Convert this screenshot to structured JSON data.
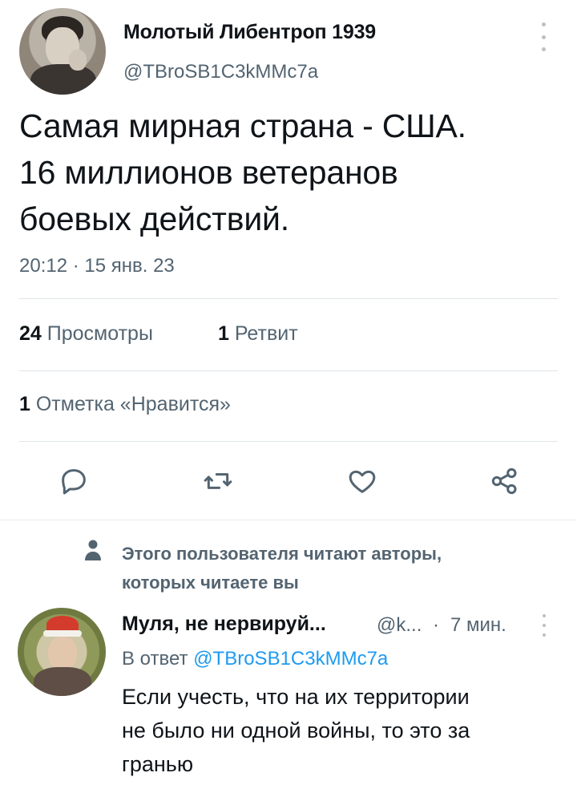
{
  "tweet": {
    "author_name": "Молотый Либентроп 1939",
    "author_handle": "@TBroSB1C3kMMc7a",
    "text": "Самая мирная страна - США.\n16 миллионов ветеранов\nбоевых действий.",
    "timestamp": "20:12 · 15 янв. 23",
    "views_count": "24",
    "views_label": "Просмотры",
    "retweets_count": "1",
    "retweets_label": "Ретвит",
    "likes_count": "1",
    "likes_label": "Отметка «Нравится»"
  },
  "actions": {
    "icons": [
      "reply-icon",
      "retweet-icon",
      "like-icon",
      "share-icon"
    ]
  },
  "social_context": {
    "text": "Этого пользователя читают авторы,\nкоторых читаете вы",
    "icon": "person-icon"
  },
  "reply": {
    "author_name": "Муля, не нервируй...",
    "author_handle": "@k...",
    "separator": "·",
    "time": "7 мин.",
    "reply_prefix": "В ответ",
    "reply_to": "@TBroSB1C3kMMc7a",
    "text": "Если учесть, что на их территории\nне было ни одной войны, то это за\nгранью"
  },
  "colors": {
    "text_primary": "#0f1419",
    "text_secondary": "#536471",
    "link": "#1d9bf0",
    "divider": "#dfe4e8"
  }
}
